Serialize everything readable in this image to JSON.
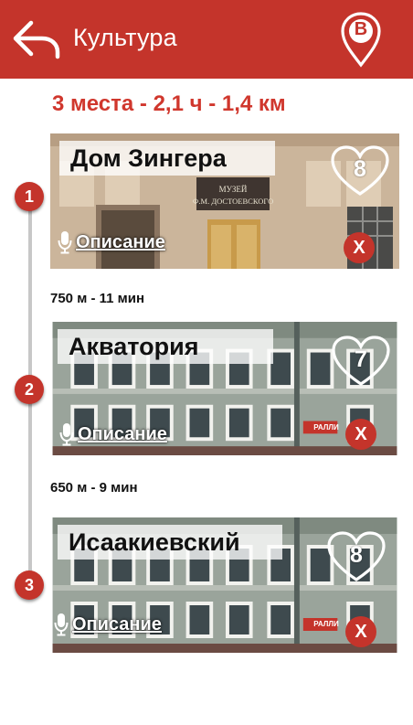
{
  "header": {
    "title": "Культура",
    "logo_letter": "B",
    "accent_color": "#c4342b"
  },
  "route_summary": "3 места - 2,1 ч - 1,4 км",
  "stops": [
    {
      "number": "1",
      "name": "Дом Зингера",
      "rating": "8",
      "description_label": "Описание",
      "remove_label": "X",
      "sign_line1": "МУЗЕЙ",
      "sign_line2": "Ф.М. ДОСТОЕВСКОГО"
    },
    {
      "number": "2",
      "name": "Акватория",
      "rating": "7",
      "description_label": "Описание",
      "remove_label": "X",
      "shop_sign": "РАЛЛИ"
    },
    {
      "number": "3",
      "name": "Исаакиевский",
      "rating": "8",
      "description_label": "Описание",
      "remove_label": "X",
      "shop_sign": "РАЛЛИ"
    }
  ],
  "legs": [
    "750 м - 11 мин",
    "650 м - 9 мин"
  ],
  "icons": {
    "back": "back-arrow-icon",
    "logo": "map-pin-logo-icon",
    "audio": "microphone-icon",
    "rating": "heart-icon",
    "remove": "close-icon"
  }
}
